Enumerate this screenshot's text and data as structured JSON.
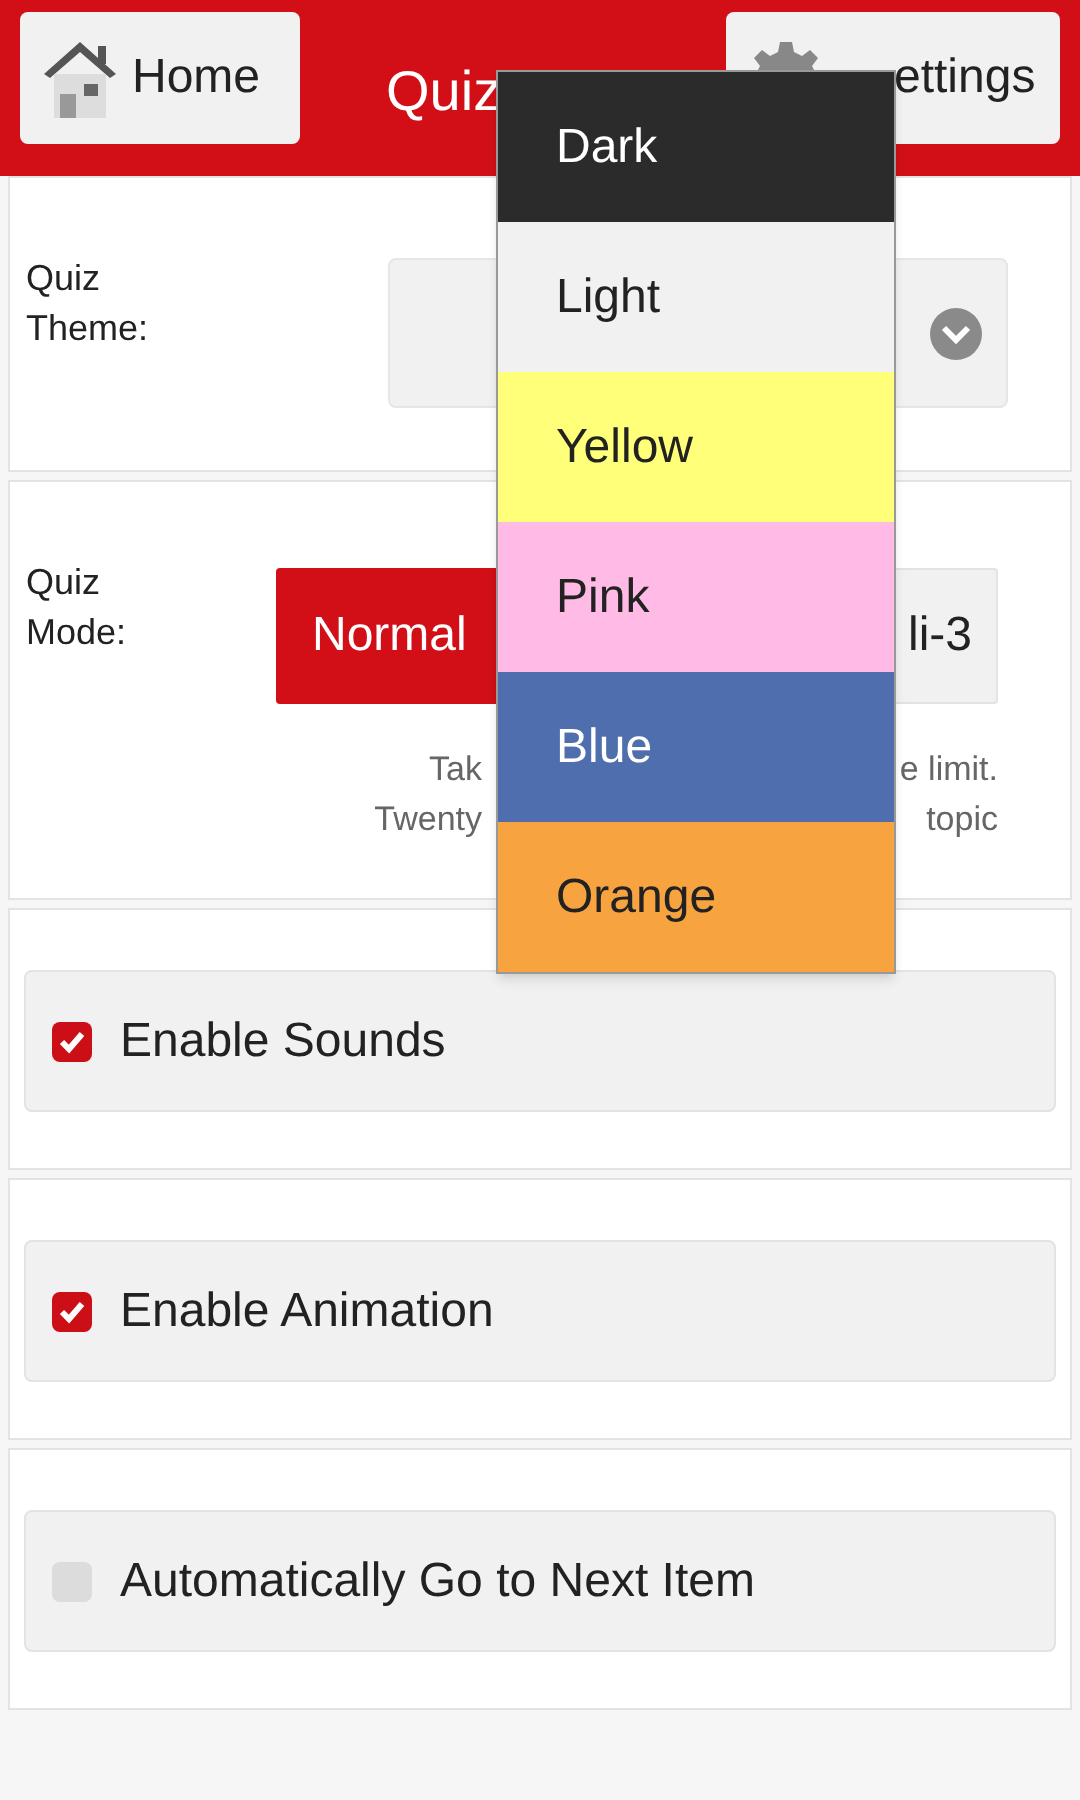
{
  "header": {
    "home_button": "Home",
    "title": "Quiz",
    "settings_button": "ettings"
  },
  "theme": {
    "label": "Quiz Theme:"
  },
  "mode": {
    "label": "Quiz Mode:",
    "options": [
      {
        "label": "Normal",
        "selected": true
      },
      {
        "label": "li-3",
        "selected": false
      }
    ],
    "description": [
      {
        "start": "Tak",
        "end": "e limit."
      },
      {
        "start": "Twenty",
        "end": "topic"
      }
    ]
  },
  "options": [
    {
      "label": "Enable Sounds",
      "checked": true
    },
    {
      "label": "Enable Animation",
      "checked": true
    },
    {
      "label": "Automatically Go to Next Item",
      "checked": false
    }
  ],
  "theme_menu": [
    {
      "label": "Dark",
      "color": "#2b2b2b"
    },
    {
      "label": "Light",
      "color": "#f1f1f1"
    },
    {
      "label": "Yellow",
      "color": "#ffff7a"
    },
    {
      "label": "Pink",
      "color": "#ffbae5"
    },
    {
      "label": "Blue",
      "color": "#4f6ead"
    },
    {
      "label": "Orange",
      "color": "#f7a440"
    }
  ]
}
